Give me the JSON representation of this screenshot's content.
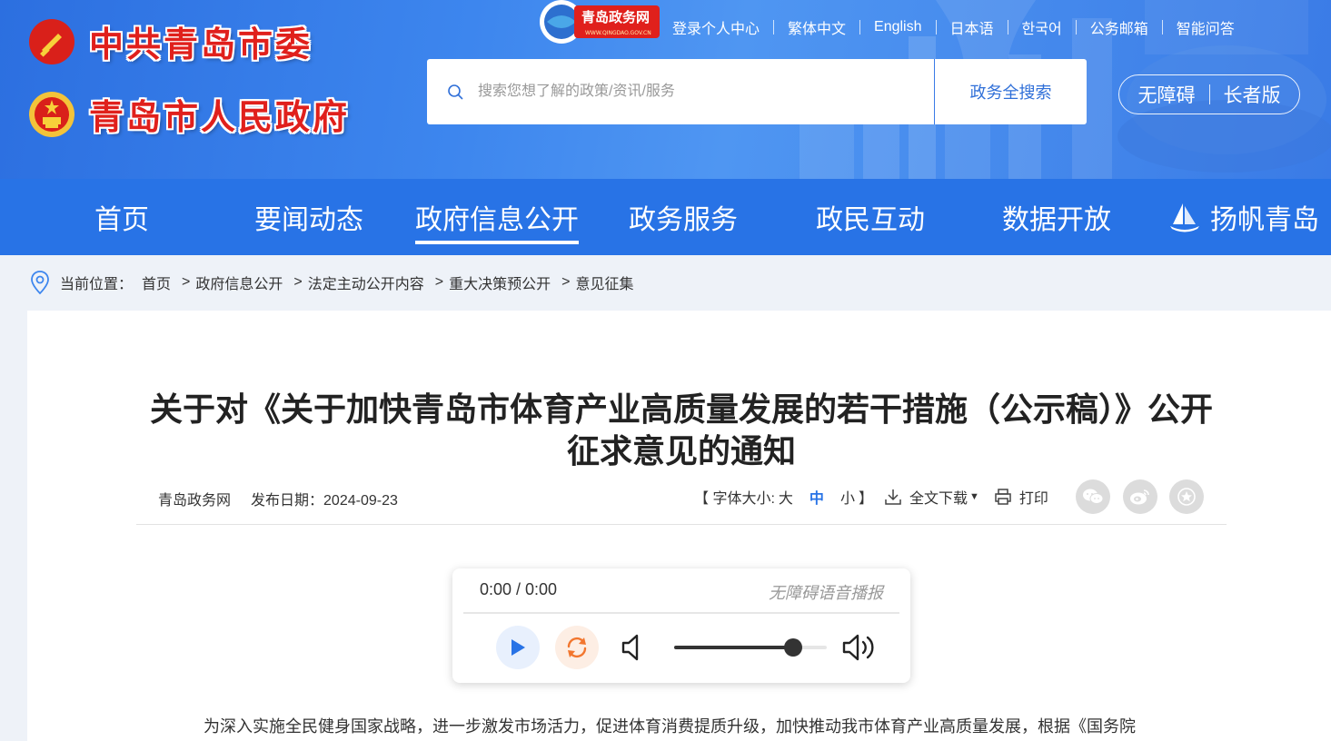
{
  "header": {
    "logo_line1": "中共青岛市委",
    "logo_line2": "青岛市人民政府",
    "site_badge": "青岛政务网",
    "site_badge_url_text": "WWW.QINGDAO.GOV.CN",
    "top_links": [
      "登录个人中心",
      "繁体中文",
      "English",
      "日本语",
      "한국어",
      "公务邮箱",
      "智能问答"
    ],
    "search": {
      "placeholder": "搜索您想了解的政策/资讯/服务",
      "button": "政务全搜索"
    },
    "accessibility": {
      "barrier_free": "无障碍",
      "elderly": "长者版"
    },
    "colors": {
      "header_blue": "#3d86ee",
      "nav_blue": "#2873e6",
      "logo_red": "#e0201c"
    }
  },
  "nav": {
    "items": [
      "首页",
      "要闻动态",
      "政府信息公开",
      "政务服务",
      "政民互动",
      "数据开放",
      "扬帆青岛"
    ],
    "active": "政府信息公开"
  },
  "breadcrumb": {
    "label": "当前位置：",
    "items": [
      "首页",
      "政府信息公开",
      "法定主动公开内容",
      "重大决策预公开",
      "意见征集"
    ]
  },
  "article": {
    "title": "关于对《关于加快青岛市体育产业高质量发展的若干措施（公示稿）》公开征求意见的通知",
    "source": "青岛政务网",
    "date_label": "发布日期：2024-09-23",
    "font_size_prefix": "【 字体大小: ",
    "font_sizes": [
      "大",
      "中",
      "小"
    ],
    "font_size_suffix": "】",
    "font_size_selected": "中",
    "download": "全文下载",
    "print": "打印",
    "share_icons": [
      "wechat-icon",
      "weibo-icon",
      "favorite-icon"
    ],
    "body_first_line": "为深入实施全民健身国家战略，进一步激发市场活力，促进体育消费提质升级，加快推动我市体育产业高质量发展，根据《国务院"
  },
  "player": {
    "time": "0:00 / 0:00",
    "label": "无障碍语音播报",
    "volume": 0.78
  }
}
